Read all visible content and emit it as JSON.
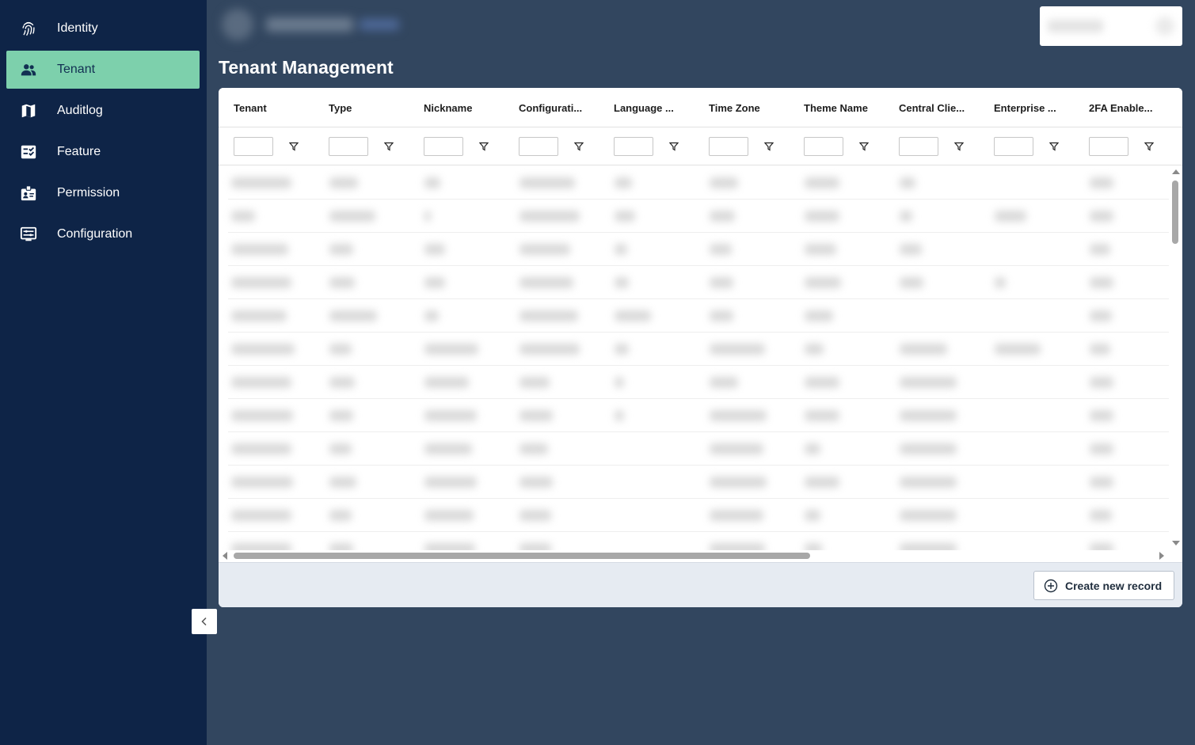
{
  "sidebar": {
    "items": [
      {
        "label": "Identity",
        "icon": "fingerprint-icon",
        "active": false
      },
      {
        "label": "Tenant",
        "icon": "people-icon",
        "active": true
      },
      {
        "label": "Auditlog",
        "icon": "map-icon",
        "active": false
      },
      {
        "label": "Feature",
        "icon": "checklist-icon",
        "active": false
      },
      {
        "label": "Permission",
        "icon": "badge-icon",
        "active": false
      },
      {
        "label": "Configuration",
        "icon": "settings-screen-icon",
        "active": false
      }
    ],
    "collapse_icon": "chevron-left-icon",
    "accent_color": "#7dd0ac",
    "background_color": "#0e2447"
  },
  "page": {
    "title": "Tenant Management",
    "background_color": "#32465f"
  },
  "grid": {
    "columns": [
      "Tenant",
      "Type",
      "Nickname",
      "Configurati...",
      "Language ...",
      "Time Zone",
      "Theme Name",
      "Central Clie...",
      "Enterprise ...",
      "2FA Enable..."
    ],
    "filter_icon": "funnel-icon"
  },
  "footer": {
    "create_label": "Create new record",
    "create_icon": "plus-circle-icon"
  }
}
